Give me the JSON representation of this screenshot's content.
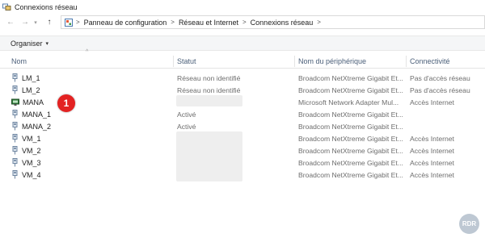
{
  "window": {
    "title": "Connexions réseau",
    "icon": "network-connections-icon"
  },
  "nav": {
    "back_icon": "arrow-left-icon",
    "forward_icon": "arrow-right-icon",
    "recent_icon": "chevron-down-icon",
    "up_icon": "arrow-up-icon"
  },
  "breadcrumb": {
    "items": [
      "Panneau de configuration",
      "Réseau et Internet",
      "Connexions réseau"
    ],
    "separator": ">"
  },
  "toolbar": {
    "organize_label": "Organiser",
    "caret": "▾"
  },
  "columns": {
    "name": "Nom",
    "status": "Statut",
    "device": "Nom du périphérique",
    "connectivity": "Connectivité",
    "sort_indicator": "^"
  },
  "rows": [
    {
      "name": "LM_1",
      "status": "Réseau non identifié",
      "device": "Broadcom NetXtreme Gigabit Et...",
      "connectivity": "Pas d'accès réseau",
      "icon": "ethernet-adapter-icon"
    },
    {
      "name": "LM_2",
      "status": "Réseau non identifié",
      "device": "Broadcom NetXtreme Gigabit Et...",
      "connectivity": "Pas d'accès réseau",
      "icon": "ethernet-adapter-icon"
    },
    {
      "name": "MANA",
      "status": "",
      "device": "Microsoft Network Adapter Mul...",
      "connectivity": "Accès Internet",
      "icon": "network-team-icon"
    },
    {
      "name": "MANA_1",
      "status": "Activé",
      "device": "Broadcom NetXtreme Gigabit Et...",
      "connectivity": "",
      "icon": "ethernet-adapter-icon"
    },
    {
      "name": "MANA_2",
      "status": "Activé",
      "device": "Broadcom NetXtreme Gigabit Et...",
      "connectivity": "",
      "icon": "ethernet-adapter-icon"
    },
    {
      "name": "VM_1",
      "status": "",
      "device": "Broadcom NetXtreme Gigabit Et...",
      "connectivity": "Accès Internet",
      "icon": "ethernet-adapter-icon"
    },
    {
      "name": "VM_2",
      "status": "",
      "device": "Broadcom NetXtreme Gigabit Et...",
      "connectivity": "Accès Internet",
      "icon": "ethernet-adapter-icon"
    },
    {
      "name": "VM_3",
      "status": "",
      "device": "Broadcom NetXtreme Gigabit Et...",
      "connectivity": "Accès Internet",
      "icon": "ethernet-adapter-icon"
    },
    {
      "name": "VM_4",
      "status": "",
      "device": "Broadcom NetXtreme Gigabit Et...",
      "connectivity": "Accès Internet",
      "icon": "ethernet-adapter-icon"
    }
  ],
  "annotation": {
    "badge_number": "1",
    "badge_color": "#e32222"
  },
  "watermark": {
    "text": "RDR"
  },
  "colors": {
    "header_text": "#4c607a",
    "toolbar_bg": "#f5f6f7"
  }
}
